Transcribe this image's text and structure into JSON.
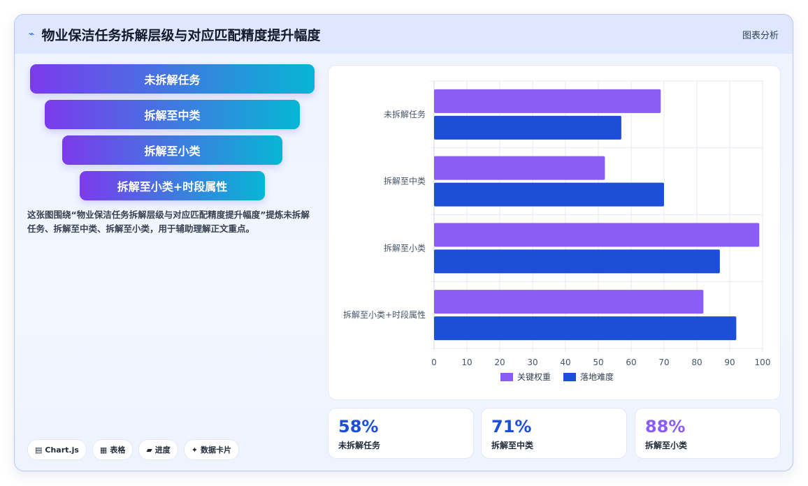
{
  "header": {
    "title": "物业保洁任务拆解层级与对应匹配精度提升幅度",
    "tag": "图表分析"
  },
  "funnel": [
    "未拆解任务",
    "拆解至中类",
    "拆解至小类",
    "拆解至小类+时段属性"
  ],
  "description": "这张图围绕“物业保洁任务拆解层级与对应匹配精度提升幅度”提炼未拆解任务、拆解至中类、拆解至小类，用于辅助理解正文重点。",
  "chips": [
    {
      "icon": "▤",
      "icon_name": "chart-icon",
      "label": "Chart.js"
    },
    {
      "icon": "▦",
      "icon_name": "table-icon",
      "label": "表格"
    },
    {
      "icon": "▰",
      "icon_name": "progress-icon",
      "label": "进度"
    },
    {
      "icon": "✦",
      "icon_name": "sparkle-icon",
      "label": "数据卡片"
    }
  ],
  "stats": [
    {
      "value": "58%",
      "label": "未拆解任务",
      "color": "#1d4ed8"
    },
    {
      "value": "71%",
      "label": "拆解至中类",
      "color": "#1d4ed8"
    },
    {
      "value": "88%",
      "label": "拆解至小类",
      "color": "#8b5cf6"
    }
  ],
  "chart_data": {
    "type": "bar",
    "orientation": "horizontal",
    "categories": [
      "未拆解任务",
      "拆解至中类",
      "拆解至小类",
      "拆解至小类+时段属性"
    ],
    "series": [
      {
        "name": "关键权重",
        "color": "#8b5cf6",
        "values": [
          69,
          52,
          99,
          82
        ]
      },
      {
        "name": "落地难度",
        "color": "#1d4ed8",
        "values": [
          57,
          70,
          87,
          92
        ]
      }
    ],
    "xlim": [
      0,
      100
    ],
    "xticks": [
      0,
      10,
      20,
      30,
      40,
      50,
      60,
      70,
      80,
      90,
      100
    ],
    "grid": true,
    "legend": "bottom"
  }
}
